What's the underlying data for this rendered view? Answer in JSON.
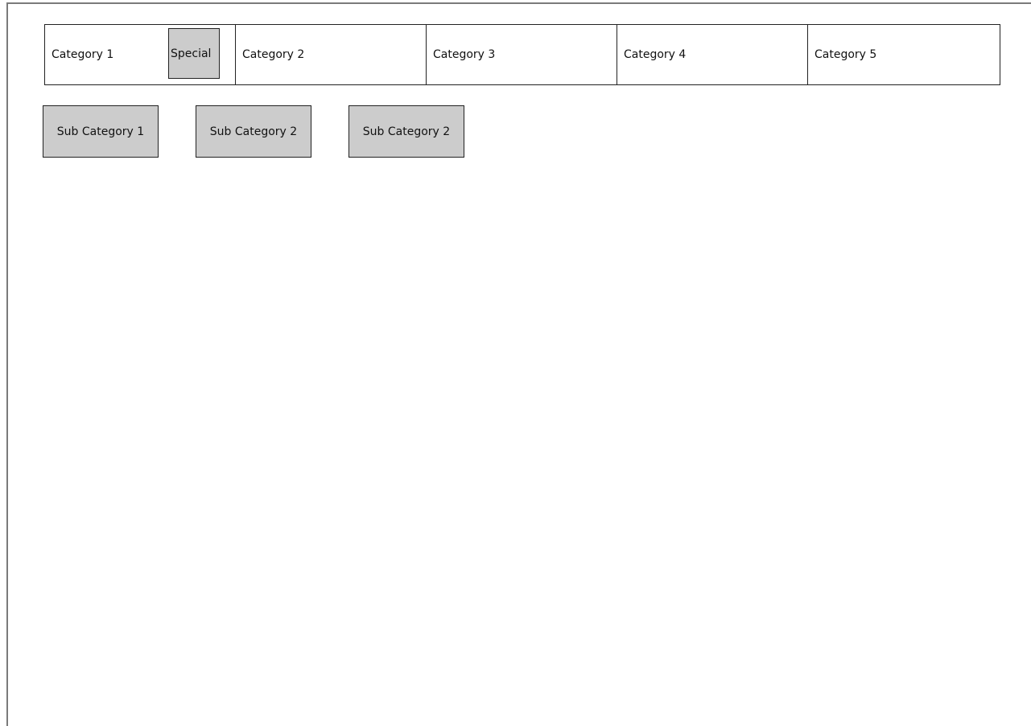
{
  "tabs": [
    {
      "label": "Category 1"
    },
    {
      "label": "Category 2"
    },
    {
      "label": "Category 3"
    },
    {
      "label": "Category 4"
    },
    {
      "label": "Category 5"
    }
  ],
  "special_button": {
    "label": "Special"
  },
  "subcategories": [
    {
      "label": "Sub Category 1"
    },
    {
      "label": "Sub Category 2"
    },
    {
      "label": "Sub Category 2"
    }
  ],
  "colors": {
    "tab_background": "#ffffff",
    "button_fill": "#cccccc",
    "border": "#222222",
    "frame_border": "#7a7a7a"
  }
}
